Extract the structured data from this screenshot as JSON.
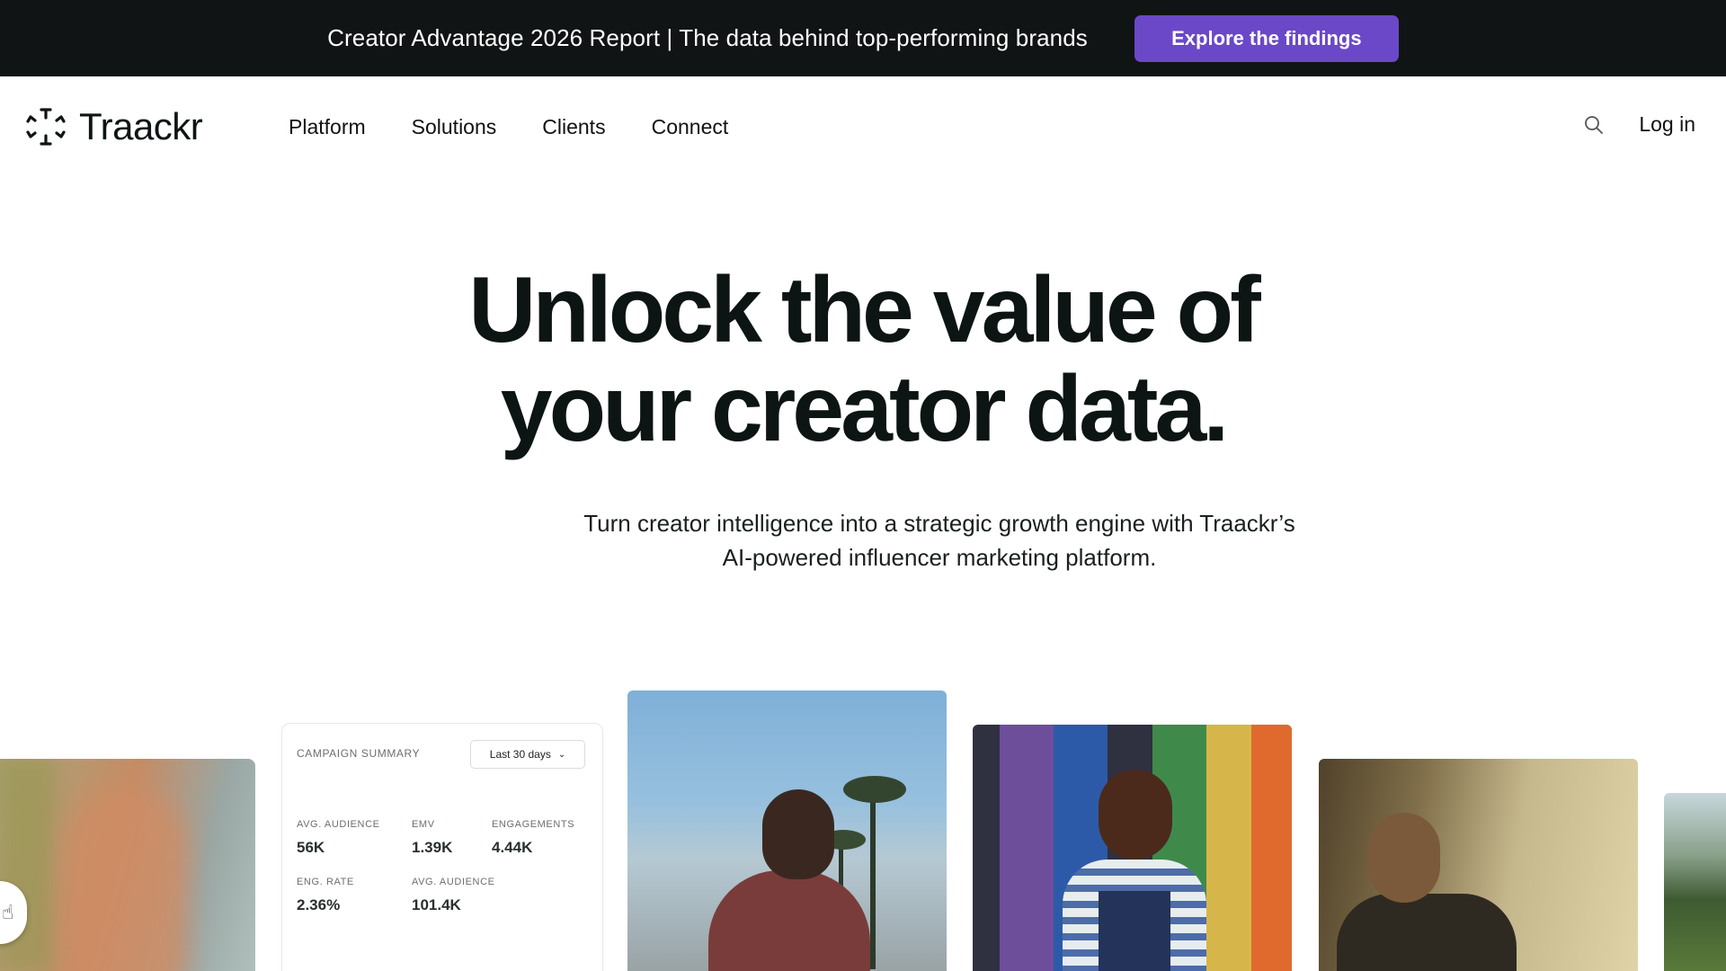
{
  "announcement": {
    "text": "Creator Advantage 2026 Report | The data behind top-performing brands",
    "cta_label": "Explore the findings",
    "cta_color": "#6a48c8",
    "background": "#111415"
  },
  "nav": {
    "logo_text": "Traackr",
    "links": [
      "Platform",
      "Solutions",
      "Clients",
      "Connect"
    ],
    "search_icon": "search-icon",
    "login_label": "Log in"
  },
  "hero": {
    "title_line1": "Unlock the value of",
    "title_line2": "your creator data.",
    "subtitle_line1": "Turn creator intelligence into a strategic growth engine with Traackr’s",
    "subtitle_line2": "AI-powered influencer marketing platform."
  },
  "campaign_summary": {
    "label": "CAMPAIGN SUMMARY",
    "range_select": "Last 30 days",
    "metrics": [
      {
        "label": "AVG. AUDIENCE",
        "value": "56K"
      },
      {
        "label": "EMV",
        "value": "1.39K"
      },
      {
        "label": "ENGAGEMENTS",
        "value": "4.44K"
      },
      {
        "label": "ENG. RATE",
        "value": "2.36%"
      },
      {
        "label": "AVG. AUDIENCE",
        "value": "101.4K"
      }
    ]
  }
}
